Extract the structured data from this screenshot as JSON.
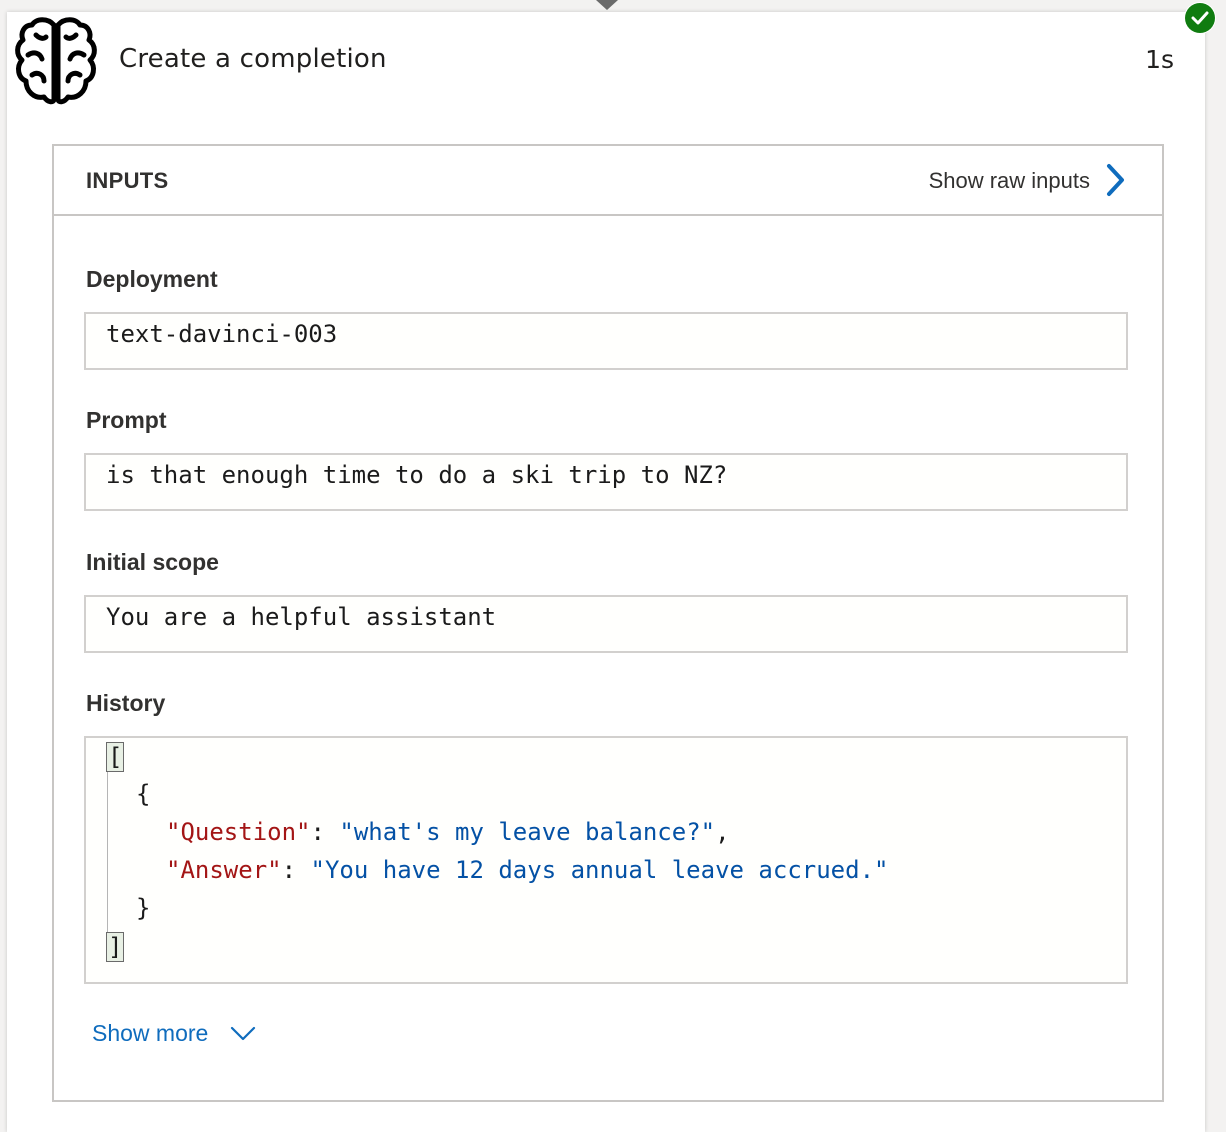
{
  "action": {
    "title": "Create a completion",
    "duration": "1s",
    "status": "succeeded",
    "icon": "brain-icon"
  },
  "inputs": {
    "header": "INPUTS",
    "raw_link_label": "Show raw inputs",
    "fields": [
      {
        "label": "Deployment",
        "value": "text-davinci-003"
      },
      {
        "label": "Prompt",
        "value": "is that enough time to do a ski trip to NZ?"
      },
      {
        "label": "Initial scope",
        "value": "You are a helpful assistant"
      }
    ],
    "history": {
      "label": "History",
      "open_bracket": "[",
      "open_brace": "{",
      "question_key": "\"Question\"",
      "question_value": "\"what's my leave balance?\"",
      "answer_key": "\"Answer\"",
      "answer_value": "\"You have 12 days annual leave accrued.\"",
      "close_brace": "}",
      "close_bracket": "]"
    },
    "show_more_label": "Show more"
  },
  "colors": {
    "success": "#107c10",
    "link": "#0f6cbd",
    "json_key": "#a31515",
    "json_string": "#0451a5"
  }
}
